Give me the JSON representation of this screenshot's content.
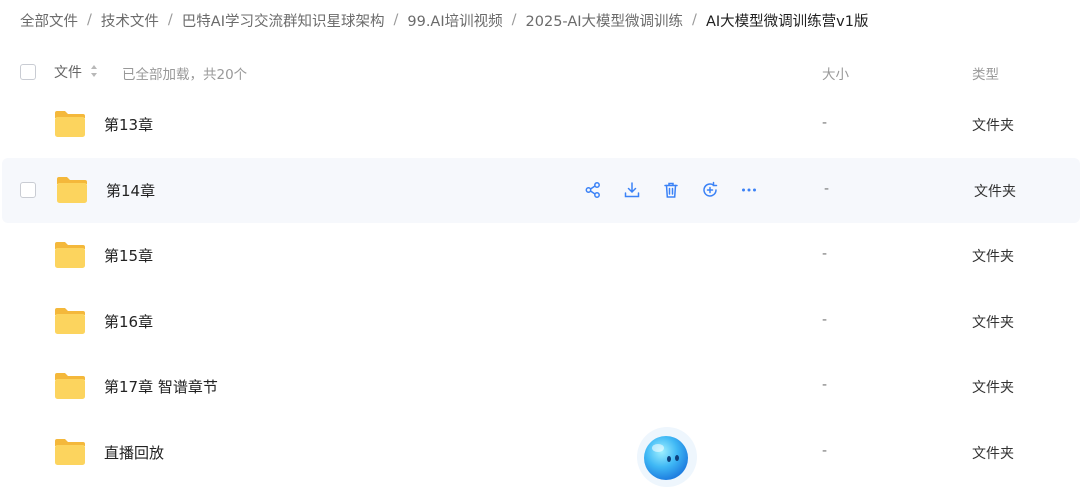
{
  "breadcrumb": [
    "全部文件",
    "技术文件",
    "巴特AI学习交流群知识星球架构",
    "99.AI培训视频",
    "2025-AI大模型微调训练",
    "AI大模型微调训练营v1版"
  ],
  "header": {
    "name_label": "文件",
    "status": "已全部加载，共20个",
    "size_label": "大小",
    "type_label": "类型"
  },
  "rows": [
    {
      "name": "第13章",
      "size": "-",
      "type": "文件夹"
    },
    {
      "name": "第14章",
      "size": "-",
      "type": "文件夹"
    },
    {
      "name": "第15章",
      "size": "-",
      "type": "文件夹"
    },
    {
      "name": "第16章",
      "size": "-",
      "type": "文件夹"
    },
    {
      "name": "第17章 智谱章节",
      "size": "-",
      "type": "文件夹"
    },
    {
      "name": "直播回放",
      "size": "-",
      "type": "文件夹"
    }
  ],
  "actions": [
    "share-icon",
    "download-icon",
    "delete-icon",
    "refresh-icon",
    "more-icon"
  ],
  "colors": {
    "accent": "#3b82f6",
    "folder": "#f9c84a",
    "hover_row": "#f6f8fc"
  }
}
